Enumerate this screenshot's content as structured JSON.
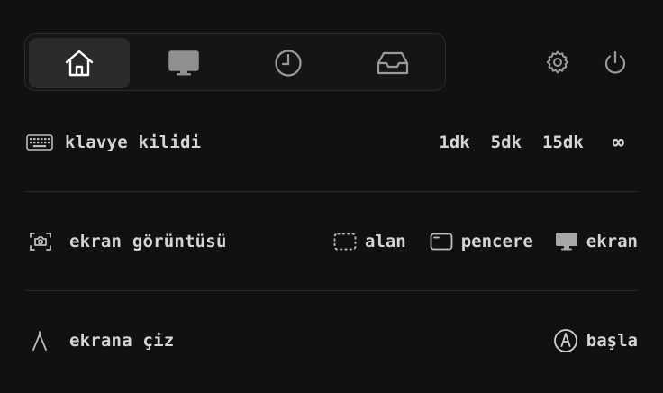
{
  "tabs": [
    {
      "icon": "home-icon",
      "active": true
    },
    {
      "icon": "monitor-icon",
      "active": false
    },
    {
      "icon": "clock-icon",
      "active": false
    },
    {
      "icon": "inbox-icon",
      "active": false
    }
  ],
  "top_icons": [
    "settings-icon",
    "power-icon"
  ],
  "keyboard_lock": {
    "label": "klavye kilidi",
    "durations": [
      "1dk",
      "5dk",
      "15dk",
      "∞"
    ]
  },
  "screenshot": {
    "label": "ekran görüntüsü",
    "options": [
      {
        "label": "alan",
        "icon": "selection-area-icon"
      },
      {
        "label": "pencere",
        "icon": "window-icon"
      },
      {
        "label": "ekran",
        "icon": "screen-icon"
      }
    ]
  },
  "draw": {
    "label": "ekrana çiz",
    "start_label": "başla"
  },
  "colors": {
    "background": "#111111",
    "active_tab": "#2a2a2a",
    "text": "#d6d6d6",
    "muted_icon": "#9a9a9a",
    "divider": "#2a2a2a"
  }
}
